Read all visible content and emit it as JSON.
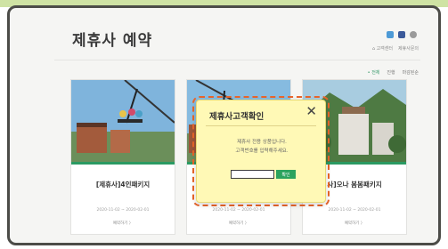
{
  "page": {
    "title": "제휴사 예약",
    "accent_color": "#2a9a62"
  },
  "header": {
    "sns_icons": [
      "twitter-icon",
      "facebook-icon",
      "link-icon"
    ],
    "util_links": [
      "고객센터",
      "제휴사문의"
    ]
  },
  "sort": {
    "options": [
      "전체",
      "진행",
      "마감된순"
    ]
  },
  "cards": [
    {
      "title": "[제휴사]4인패키지",
      "date": "2020-11-02 ~ 2020-02-01",
      "meta": "예약하기 〉"
    },
    {
      "title": "",
      "date": "2020-11-02 ~ 2020-02-01",
      "meta": "예약하기 〉"
    },
    {
      "title": "사]오나 봄봄패키지",
      "date": "2020-11-02 ~ 2020-02-01",
      "meta": "예약하기 〉"
    }
  ],
  "modal": {
    "title": "제휴사고객확인",
    "close_symbol": "✕",
    "message_line1": "제휴사 전용 상품입니다.",
    "message_line2": "고객번호를 입력해주세요.",
    "input_value": "",
    "input_placeholder": "",
    "confirm_label": "확인",
    "confirm_color": "#2ba35e",
    "highlight_color": "#e8652a"
  }
}
